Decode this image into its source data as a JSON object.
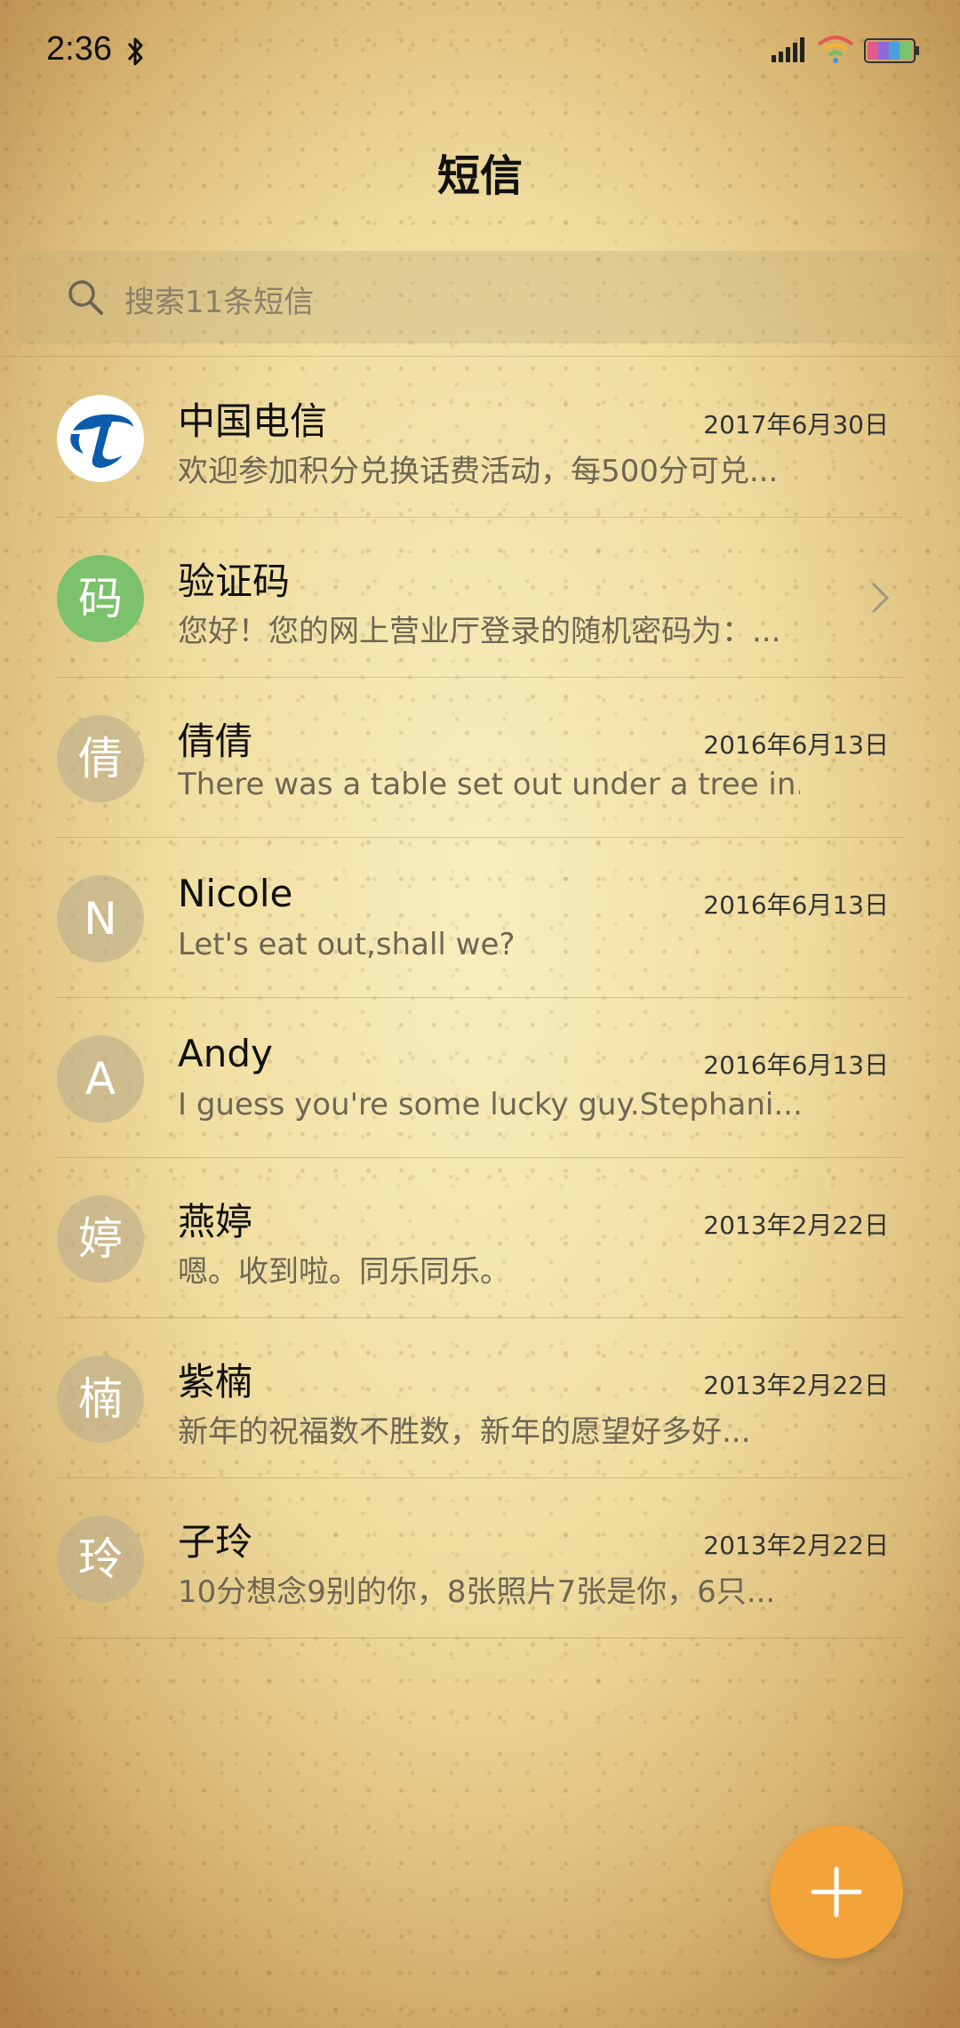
{
  "status_bar": {
    "time": "2:36",
    "icons": [
      "bluetooth-icon",
      "signal-icon",
      "wifi-icon",
      "battery-icon"
    ]
  },
  "header": {
    "title": "短信"
  },
  "search": {
    "placeholder": "搜索11条短信"
  },
  "conversations": [
    {
      "name": "中国电信",
      "date": "2017年6月30日",
      "preview": "欢迎参加积分兑换话费活动，每500分可兑...",
      "avatar_text": "",
      "avatar_type": "logo"
    },
    {
      "name": "验证码",
      "date": "",
      "preview": "您好！您的网上营业厅登录的随机密码为：...",
      "avatar_text": "码",
      "avatar_type": "green",
      "has_chevron": true
    },
    {
      "name": "倩倩",
      "date": "2016年6月13日",
      "preview": "There was a table set out under a tree in...",
      "avatar_text": "倩",
      "avatar_type": "default"
    },
    {
      "name": "Nicole",
      "date": "2016年6月13日",
      "preview": "Let's eat out,shall we?",
      "avatar_text": "N",
      "avatar_type": "default"
    },
    {
      "name": "Andy",
      "date": "2016年6月13日",
      "preview": "I guess you're some lucky guy.Stephani...",
      "avatar_text": "A",
      "avatar_type": "default"
    },
    {
      "name": "燕婷",
      "date": "2013年2月22日",
      "preview": "嗯。收到啦。同乐同乐。",
      "avatar_text": "婷",
      "avatar_type": "default"
    },
    {
      "name": "紫楠",
      "date": "2013年2月22日",
      "preview": "新年的祝福数不胜数，新年的愿望好多好...",
      "avatar_text": "楠",
      "avatar_type": "default"
    },
    {
      "name": "子玲",
      "date": "2013年2月22日",
      "preview": "10分想念9别的你，8张照片7张是你，6只...",
      "avatar_text": "玲",
      "avatar_type": "default"
    }
  ],
  "fab": {
    "icon": "plus-icon",
    "color": "#f2a33a"
  },
  "colors": {
    "accent": "#f2a33a",
    "green_avatar": "#7cc16b",
    "telecom_blue": "#0b5cad"
  }
}
